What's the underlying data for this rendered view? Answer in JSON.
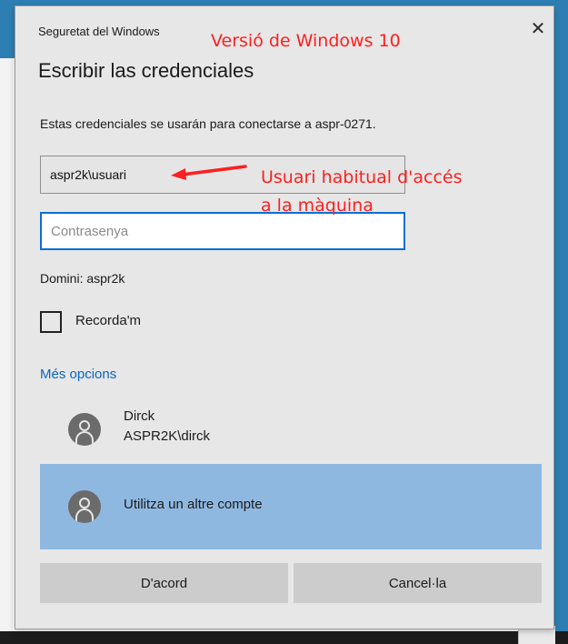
{
  "dialog": {
    "app_title": "Seguretat del Windows",
    "heading": "Escribir las credenciales",
    "description": "Estas credenciales se usarán para conectarse a aspr-0271.",
    "username_value": "aspr2k\\usuari",
    "password_placeholder": "Contrasenya",
    "domain_text": "Domini: aspr2k",
    "remember_label": "Recorda'm",
    "remember_checked": false,
    "more_options_label": "Més opcions",
    "accounts": [
      {
        "name": "Dirck",
        "user": "ASPR2K\\dirck",
        "icon": "user-icon"
      }
    ],
    "other_account_label": "Utilitza un altre compte",
    "ok_label": "D'acord",
    "cancel_label": "Cancel·la",
    "close_icon": "close-icon"
  },
  "annotations": {
    "version_note": "Versió de Windows 10",
    "user_note_line1": "Usuari habitual d'accés",
    "user_note_line2": "a la màquina",
    "color": "#ff1f1f"
  },
  "colors": {
    "desktop_blue": "#2d7fb3",
    "dialog_bg": "#e7e7e7",
    "accent_focus": "#0a6fd1",
    "link": "#0a64bd",
    "selected_item": "#8fb8e1",
    "button_bg": "#cccccc"
  }
}
